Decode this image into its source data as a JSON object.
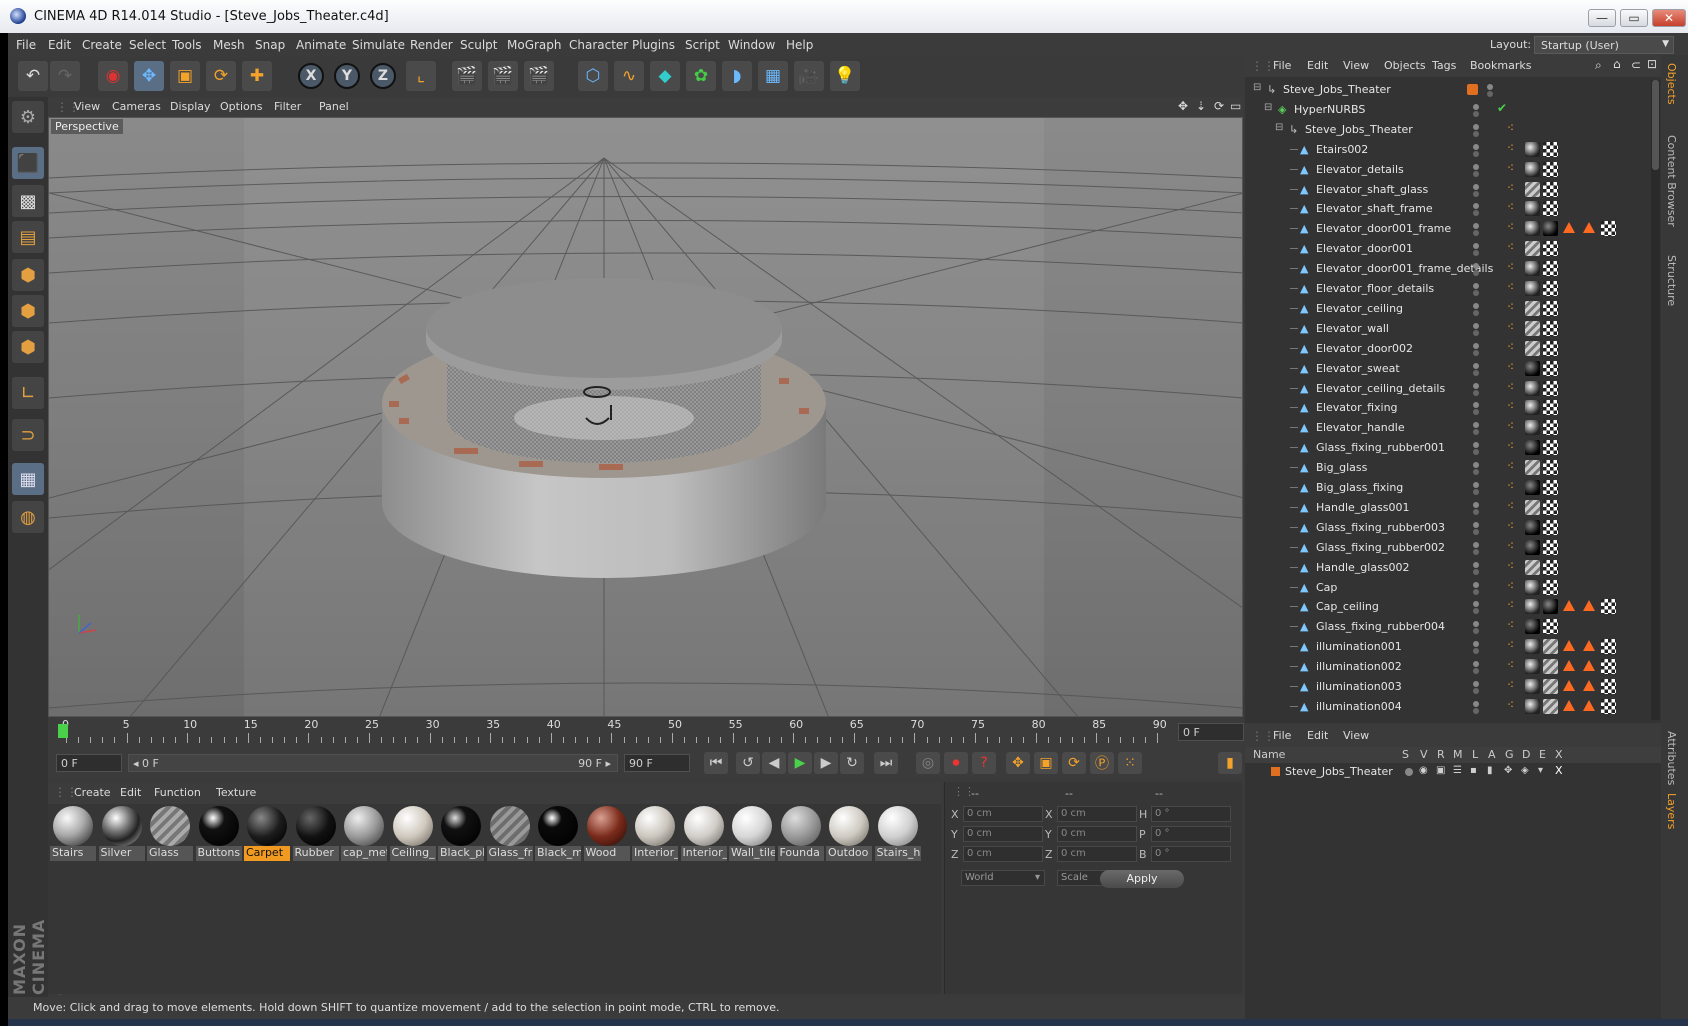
{
  "window": {
    "title": "CINEMA 4D R14.014 Studio - [Steve_Jobs_Theater.c4d]",
    "min": "—",
    "max": "▭",
    "close": "✕"
  },
  "menu": [
    "File",
    "Edit",
    "Create",
    "Select",
    "Tools",
    "Mesh",
    "Snap",
    "Animate",
    "Simulate",
    "Render",
    "Sculpt",
    "MoGraph",
    "Character",
    "Plugins",
    "Script",
    "Window",
    "Help"
  ],
  "layout": {
    "label": "Layout:",
    "value": "Startup (User)"
  },
  "viewport": {
    "menu": [
      "View",
      "Cameras",
      "Display",
      "Options",
      "Filter",
      "Panel"
    ],
    "label": "Perspective"
  },
  "timeline": {
    "ticks": [
      "0",
      "5",
      "10",
      "15",
      "20",
      "25",
      "30",
      "35",
      "40",
      "45",
      "50",
      "55",
      "60",
      "65",
      "70",
      "75",
      "80",
      "85",
      "90"
    ],
    "frame_field": "0 F"
  },
  "transport": {
    "start": "0 F",
    "range_start": "◂ 0 F",
    "range_end": "90 F ▸",
    "end": "90 F"
  },
  "materials": {
    "menu": [
      "Create",
      "Edit",
      "Function",
      "Texture"
    ],
    "items": [
      {
        "label": "Stairs",
        "ball": "radial-gradient(circle at 35% 30%,#fafafa,#aaa 45%,#333 90%)"
      },
      {
        "label": "Silver",
        "ball": "radial-gradient(circle at 35% 30%,#fff,#777 35%,#222 60%,#999 90%)"
      },
      {
        "label": "Glass",
        "ball": "repeating-linear-gradient(135deg,#aaa 0 4px,#777 4px 8px)"
      },
      {
        "label": "Buttons",
        "ball": "radial-gradient(circle at 35% 30%,#fff,#111 30%,#000 90%)"
      },
      {
        "label": "Carpet",
        "ball": "radial-gradient(circle at 35% 30%,#888,#1c1c1c 50%,#000 90%)"
      },
      {
        "label": "Rubber",
        "ball": "radial-gradient(circle at 35% 30%,#666,#111 50%,#000 90%)"
      },
      {
        "label": "cap_met",
        "ball": "radial-gradient(circle at 35% 30%,#eee,#999 50%,#444 90%)"
      },
      {
        "label": "Ceiling_",
        "ball": "radial-gradient(circle at 35% 30%,#fff,#cfc8bd 50%,#6d675f 95%)"
      },
      {
        "label": "Black_pl",
        "ball": "radial-gradient(circle at 35% 30%,#ddd,#111 30%,#000 90%)"
      },
      {
        "label": "Glass_fr",
        "ball": "repeating-linear-gradient(135deg,#999 0 4px,#6d6d6d 4px 8px)"
      },
      {
        "label": "Black_m",
        "ball": "radial-gradient(circle at 35% 30%,#fff,#0a0a0a 25%,#000 90%)"
      },
      {
        "label": "Wood",
        "ball": "radial-gradient(circle at 35% 30%,#d9a091,#7a2a1a 50%,#2b0d06 95%)"
      },
      {
        "label": "Interior_",
        "ball": "radial-gradient(circle at 35% 30%,#fff,#cbc6bd 50%,#6d675f 95%)"
      },
      {
        "label": "Interior_",
        "ball": "radial-gradient(circle at 35% 30%,#fff,#d0cdc8 50%,#706c66 95%)"
      },
      {
        "label": "Wall_tile",
        "ball": "radial-gradient(circle at 35% 30%,#fff,#d6d6d6 50%,#777 95%)"
      },
      {
        "label": "Founda",
        "ball": "radial-gradient(circle at 35% 30%,#ddd,#999 50%,#555 95%)"
      },
      {
        "label": "Outdoo",
        "ball": "radial-gradient(circle at 35% 30%,#fff,#cfcac2 50%,#6d6961 95%)"
      },
      {
        "label": "Stairs_h",
        "ball": "radial-gradient(circle at 35% 30%,#fff,#d0d0d0 50%,#777 95%)"
      }
    ]
  },
  "coords": {
    "headers": [
      "--",
      "--",
      "--"
    ],
    "rows": [
      {
        "a": "X",
        "av": "0 cm",
        "b": "X",
        "bv": "0 cm",
        "c": "H",
        "cv": "0 °"
      },
      {
        "a": "Y",
        "av": "0 cm",
        "b": "Y",
        "bv": "0 cm",
        "c": "P",
        "cv": "0 °"
      },
      {
        "a": "Z",
        "av": "0 cm",
        "b": "Z",
        "bv": "0 cm",
        "c": "B",
        "cv": "0 °"
      }
    ],
    "mode1": "World",
    "mode2": "Scale",
    "apply": "Apply"
  },
  "status": "Move: Click and drag to move elements. Hold down SHIFT to quantize movement / add to the selection in point mode, CTRL to remove.",
  "objects": {
    "menu": [
      "File",
      "Edit",
      "View",
      "Objects",
      "Tags",
      "Bookmarks"
    ],
    "rows": [
      {
        "name": "Steve_Jobs_Theater",
        "level": 0,
        "kind": "null",
        "tags": "orange"
      },
      {
        "name": "HyperNURBS",
        "level": 1,
        "kind": "nurbs",
        "tags": "check"
      },
      {
        "name": "Steve_Jobs_Theater",
        "level": 2,
        "kind": "null",
        "tags": "none"
      },
      {
        "name": "Etairs002",
        "level": 3,
        "kind": "poly",
        "tags": "m1"
      },
      {
        "name": "Elevator_details",
        "level": 3,
        "kind": "poly",
        "tags": "m1"
      },
      {
        "name": "Elevator_shaft_glass",
        "level": 3,
        "kind": "poly",
        "tags": "m3"
      },
      {
        "name": "Elevator_shaft_frame",
        "level": 3,
        "kind": "poly",
        "tags": "m1"
      },
      {
        "name": "Elevator_door001_frame",
        "level": 3,
        "kind": "poly",
        "tags": "multi"
      },
      {
        "name": "Elevator_door001",
        "level": 3,
        "kind": "poly",
        "tags": "m3"
      },
      {
        "name": "Elevator_door001_frame_details",
        "level": 3,
        "kind": "poly",
        "tags": "m1"
      },
      {
        "name": "Elevator_floor_details",
        "level": 3,
        "kind": "poly",
        "tags": "m1"
      },
      {
        "name": "Elevator_ceiling",
        "level": 3,
        "kind": "poly",
        "tags": "m3"
      },
      {
        "name": "Elevator_wall",
        "level": 3,
        "kind": "poly",
        "tags": "m3"
      },
      {
        "name": "Elevator_door002",
        "level": 3,
        "kind": "poly",
        "tags": "m3"
      },
      {
        "name": "Elevator_sweat",
        "level": 3,
        "kind": "poly",
        "tags": "m2"
      },
      {
        "name": "Elevator_ceiling_details",
        "level": 3,
        "kind": "poly",
        "tags": "m1"
      },
      {
        "name": "Elevator_fixing",
        "level": 3,
        "kind": "poly",
        "tags": "m1"
      },
      {
        "name": "Elevator_handle",
        "level": 3,
        "kind": "poly",
        "tags": "m1"
      },
      {
        "name": "Glass_fixing_rubber001",
        "level": 3,
        "kind": "poly",
        "tags": "m2"
      },
      {
        "name": "Big_glass",
        "level": 3,
        "kind": "poly",
        "tags": "m3"
      },
      {
        "name": "Big_glass_fixing",
        "level": 3,
        "kind": "poly",
        "tags": "m2"
      },
      {
        "name": "Handle_glass001",
        "level": 3,
        "kind": "poly",
        "tags": "m3"
      },
      {
        "name": "Glass_fixing_rubber003",
        "level": 3,
        "kind": "poly",
        "tags": "m2"
      },
      {
        "name": "Glass_fixing_rubber002",
        "level": 3,
        "kind": "poly",
        "tags": "m2"
      },
      {
        "name": "Handle_glass002",
        "level": 3,
        "kind": "poly",
        "tags": "m3"
      },
      {
        "name": "Cap",
        "level": 3,
        "kind": "poly",
        "tags": "m1"
      },
      {
        "name": "Cap_ceiling",
        "level": 3,
        "kind": "poly",
        "tags": "multi"
      },
      {
        "name": "Glass_fixing_rubber004",
        "level": 3,
        "kind": "poly",
        "tags": "m2"
      },
      {
        "name": "illumination001",
        "level": 3,
        "kind": "poly",
        "tags": "multi3"
      },
      {
        "name": "illumination002",
        "level": 3,
        "kind": "poly",
        "tags": "multi3"
      },
      {
        "name": "illumination003",
        "level": 3,
        "kind": "poly",
        "tags": "multi3"
      },
      {
        "name": "illumination004",
        "level": 3,
        "kind": "poly",
        "tags": "multi3"
      }
    ]
  },
  "layers": {
    "menu": [
      "File",
      "Edit",
      "View"
    ],
    "cols": [
      "Name",
      "S",
      "V",
      "R",
      "M",
      "L",
      "A",
      "G",
      "D",
      "E",
      "X"
    ],
    "rows": [
      {
        "name": "Steve_Jobs_Theater",
        "color": "#e07020"
      }
    ]
  },
  "sidetabs": [
    "Objects",
    "Content Browser",
    "Structure",
    "Attributes",
    "Layers"
  ],
  "brand": "MAXON CINEMA 4D",
  "colors": {
    "accent": "#f09a22",
    "selection": "#5a6f86",
    "tag_warning": "#ff6a22"
  }
}
